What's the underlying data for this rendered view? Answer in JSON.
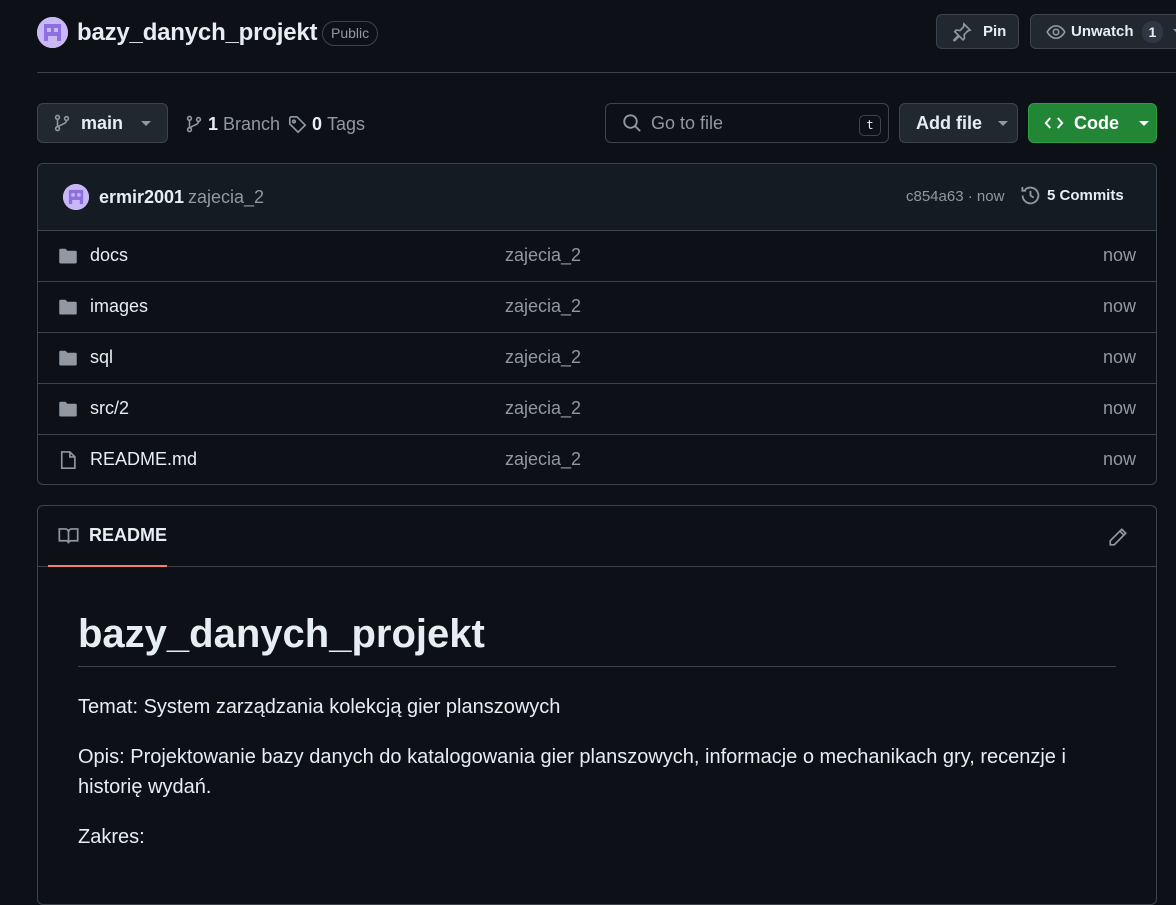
{
  "repo": {
    "name": "bazy_danych_projekt",
    "visibility": "Public",
    "pin_label": "Pin",
    "watch_label": "Unwatch",
    "watch_count": "1"
  },
  "toolbar": {
    "branch": "main",
    "branch_count": "1",
    "branch_label": "Branch",
    "tag_count": "0",
    "tag_label": "Tags",
    "search_placeholder": "Go to file",
    "search_shortcut": "t",
    "add_file_label": "Add file",
    "code_label": "Code"
  },
  "latest_commit": {
    "author": "ermir2001",
    "message": "zajecia_2",
    "hash_time": "c854a63 · now",
    "commits_label": "5 Commits"
  },
  "files": [
    {
      "type": "folder",
      "name": "docs",
      "message": "zajecia_2",
      "time": "now"
    },
    {
      "type": "folder",
      "name": "images",
      "message": "zajecia_2",
      "time": "now"
    },
    {
      "type": "folder",
      "name": "sql",
      "message": "zajecia_2",
      "time": "now"
    },
    {
      "type": "folder",
      "name": "src/2",
      "message": "zajecia_2",
      "time": "now"
    },
    {
      "type": "file",
      "name": "README.md",
      "message": "zajecia_2",
      "time": "now"
    }
  ],
  "readme": {
    "tab_label": "README",
    "title": "bazy_danych_projekt",
    "paragraphs": [
      "Temat: System zarządzania kolekcją gier planszowych",
      "Opis: Projektowanie bazy danych do katalogowania gier planszowych, informacje o mechanikach gry, recenzje i historię wydań.",
      "Zakres:"
    ]
  },
  "colors": {
    "background": "#0d1117",
    "border": "#3d444d",
    "muted_text": "#9198a1",
    "code_button": "#238636",
    "tab_underline": "#f78166"
  }
}
